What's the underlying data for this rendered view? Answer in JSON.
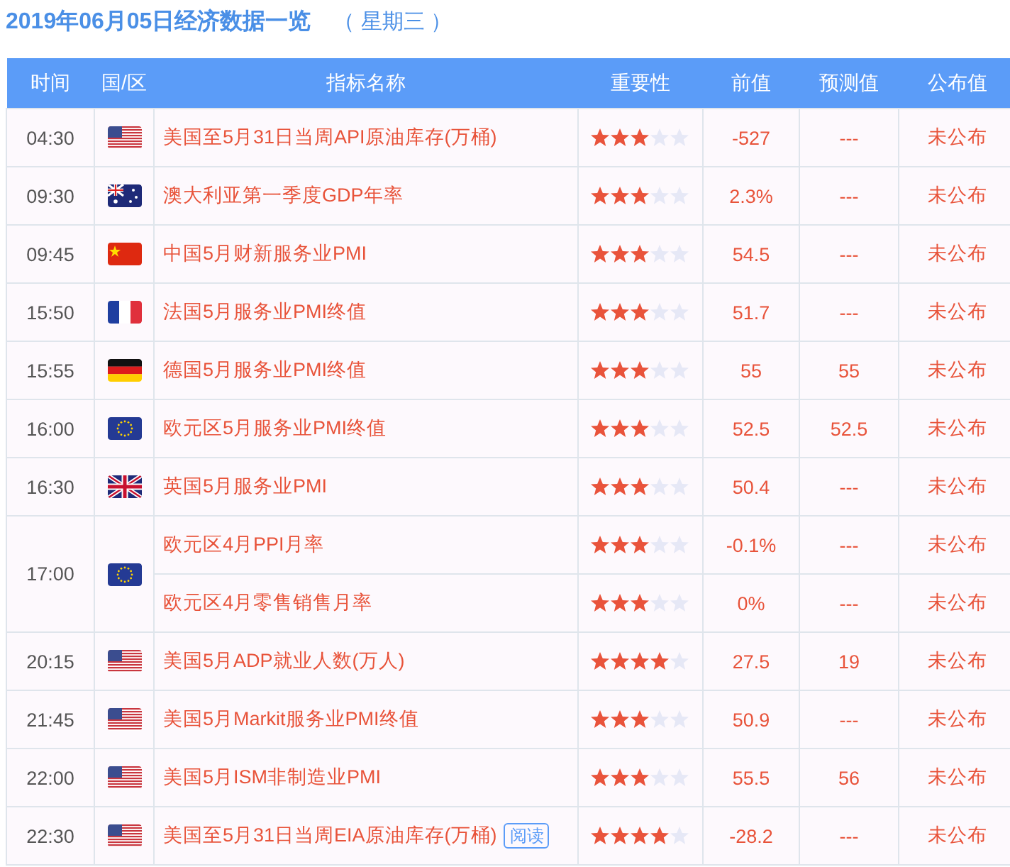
{
  "title": {
    "date": "2019年06月05日经济数据一览",
    "weekday": "（ 星期三 ）"
  },
  "table": {
    "columns": [
      "时间",
      "国/区",
      "指标名称",
      "重要性",
      "前值",
      "预测值",
      "公布值"
    ],
    "rows": [
      {
        "time": "04:30",
        "kind": "us",
        "items": [
          {
            "name": "美国至5月31日当周API原油库存(万桶)",
            "stars": 3,
            "previous": "-527",
            "forecast": "---",
            "actual": "未公布"
          }
        ]
      },
      {
        "time": "09:30",
        "kind": "au",
        "items": [
          {
            "name": "澳大利亚第一季度GDP年率",
            "stars": 3,
            "previous": "2.3%",
            "forecast": "---",
            "actual": "未公布"
          }
        ]
      },
      {
        "time": "09:45",
        "kind": "cn",
        "items": [
          {
            "name": "中国5月财新服务业PMI",
            "stars": 3,
            "previous": "54.5",
            "forecast": "---",
            "actual": "未公布"
          }
        ]
      },
      {
        "time": "15:50",
        "kind": "fr",
        "items": [
          {
            "name": "法国5月服务业PMI终值",
            "stars": 3,
            "previous": "51.7",
            "forecast": "---",
            "actual": "未公布"
          }
        ]
      },
      {
        "time": "15:55",
        "kind": "de",
        "items": [
          {
            "name": "德国5月服务业PMI终值",
            "stars": 3,
            "previous": "55",
            "forecast": "55",
            "actual": "未公布"
          }
        ]
      },
      {
        "time": "16:00",
        "kind": "eu",
        "items": [
          {
            "name": "欧元区5月服务业PMI终值",
            "stars": 3,
            "previous": "52.5",
            "forecast": "52.5",
            "actual": "未公布"
          }
        ]
      },
      {
        "time": "16:30",
        "kind": "gb",
        "items": [
          {
            "name": "英国5月服务业PMI",
            "stars": 3,
            "previous": "50.4",
            "forecast": "---",
            "actual": "未公布"
          }
        ]
      },
      {
        "time": "17:00",
        "kind": "eu",
        "items": [
          {
            "name": "欧元区4月PPI月率",
            "stars": 3,
            "previous": "-0.1%",
            "forecast": "---",
            "actual": "未公布"
          },
          {
            "name": "欧元区4月零售销售月率",
            "stars": 3,
            "previous": "0%",
            "forecast": "---",
            "actual": "未公布"
          }
        ]
      },
      {
        "time": "20:15",
        "kind": "us",
        "items": [
          {
            "name": "美国5月ADP就业人数(万人)",
            "stars": 4,
            "previous": "27.5",
            "forecast": "19",
            "actual": "未公布"
          }
        ]
      },
      {
        "time": "21:45",
        "kind": "us",
        "items": [
          {
            "name": "美国5月Markit服务业PMI终值",
            "stars": 3,
            "previous": "50.9",
            "forecast": "---",
            "actual": "未公布"
          }
        ]
      },
      {
        "time": "22:00",
        "kind": "us",
        "items": [
          {
            "name": "美国5月ISM非制造业PMI",
            "stars": 3,
            "previous": "55.5",
            "forecast": "56",
            "actual": "未公布"
          }
        ]
      },
      {
        "time": "22:30",
        "kind": "us",
        "items": [
          {
            "name": "美国至5月31日当周EIA原油库存(万桶)",
            "link": "阅读",
            "stars": 4,
            "previous": "-28.2",
            "forecast": "---",
            "actual": "未公布"
          }
        ]
      }
    ]
  }
}
